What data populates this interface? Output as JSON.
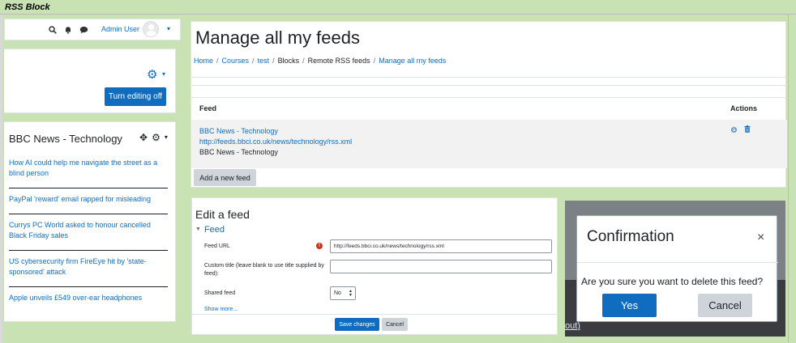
{
  "sheet": {
    "title": "RSS Block"
  },
  "navbar": {
    "search_icon": "search-icon",
    "bell_icon": "bell-icon",
    "chat_icon": "chat-icon",
    "user_name": "Admin User",
    "caret": "▾"
  },
  "edit_block": {
    "gear_icon": "gear-icon",
    "turn_editing_label": "Turn editing off"
  },
  "rss_block": {
    "title": "BBC News - Technology",
    "items": [
      "How AI could help me navigate the street as a blind person",
      "PayPal 'reward' email rapped for misleading",
      "Currys PC World asked to honour cancelled Black Friday sales",
      "US cybersecurity firm FireEye hit by 'state-sponsored' attack",
      "Apple unveils £549 over-ear headphones"
    ]
  },
  "manage": {
    "heading": "Manage all my feeds",
    "breadcrumb": [
      "Home",
      "Courses",
      "test",
      "Blocks",
      "Remote RSS feeds",
      "Manage all my feeds"
    ],
    "breadcrumb_sep": "/",
    "table": {
      "col_feed": "Feed",
      "col_actions": "Actions",
      "rows": [
        {
          "title": "BBC News - Technology",
          "url": "http://feeds.bbci.co.uk/news/technology/rss.xml",
          "description": "BBC News - Technology"
        }
      ]
    },
    "add_button": "Add a new feed"
  },
  "edit_feed": {
    "heading": "Edit a feed",
    "legend": "Feed",
    "feed_url_label": "Feed URL",
    "feed_url_value": "http://feeds.bbci.co.uk/news/technology/rss.xml",
    "required_icon": "!",
    "custom_title_label": "Custom title (leave blank to use title supplied by feed):",
    "custom_title_value": "",
    "shared_label": "Shared feed",
    "shared_value": "No",
    "show_more": "Show more...",
    "save_button": "Save changes",
    "cancel_button": "Cancel"
  },
  "modal": {
    "title": "Confirmation",
    "close": "×",
    "body": "Are you sure you want to delete this feed?",
    "yes": "Yes",
    "cancel": "Cancel",
    "background_fragment": "out)"
  },
  "colors": {
    "background": "#c8e2b4",
    "brand_primary": "#0f6cbf",
    "secondary_button": "#ced4da",
    "required": "#ca3120"
  }
}
